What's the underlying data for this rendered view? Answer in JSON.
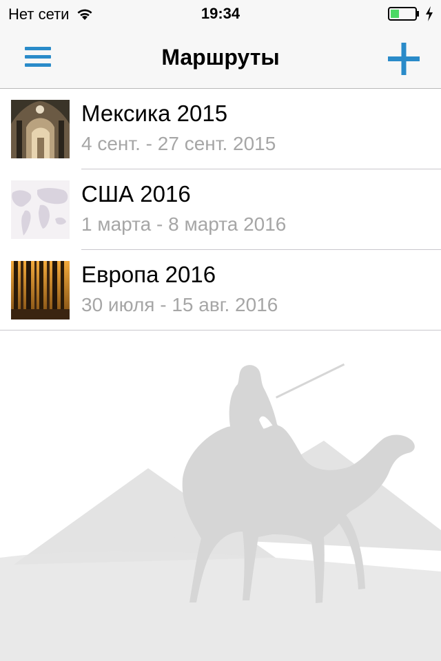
{
  "status_bar": {
    "carrier": "Нет сети",
    "time": "19:34",
    "battery_color": "#4cd964"
  },
  "nav": {
    "title": "Маршруты",
    "menu_icon": "hamburger-menu-icon",
    "add_icon": "plus-icon",
    "accent_color": "#2a8bc9"
  },
  "routes": [
    {
      "title": "Мексика 2015",
      "dates": "4 сент. - 27 сент. 2015",
      "thumbnail": "cathedral-interior-photo"
    },
    {
      "title": "США 2016",
      "dates": "1 марта - 8 марта 2016",
      "thumbnail": "world-map-photo"
    },
    {
      "title": "Европа 2016",
      "dates": "30 июля - 15 авг. 2016",
      "thumbnail": "forest-sunset-photo"
    }
  ],
  "background": {
    "illustration": "camel-rider-pyramids-watermark"
  }
}
